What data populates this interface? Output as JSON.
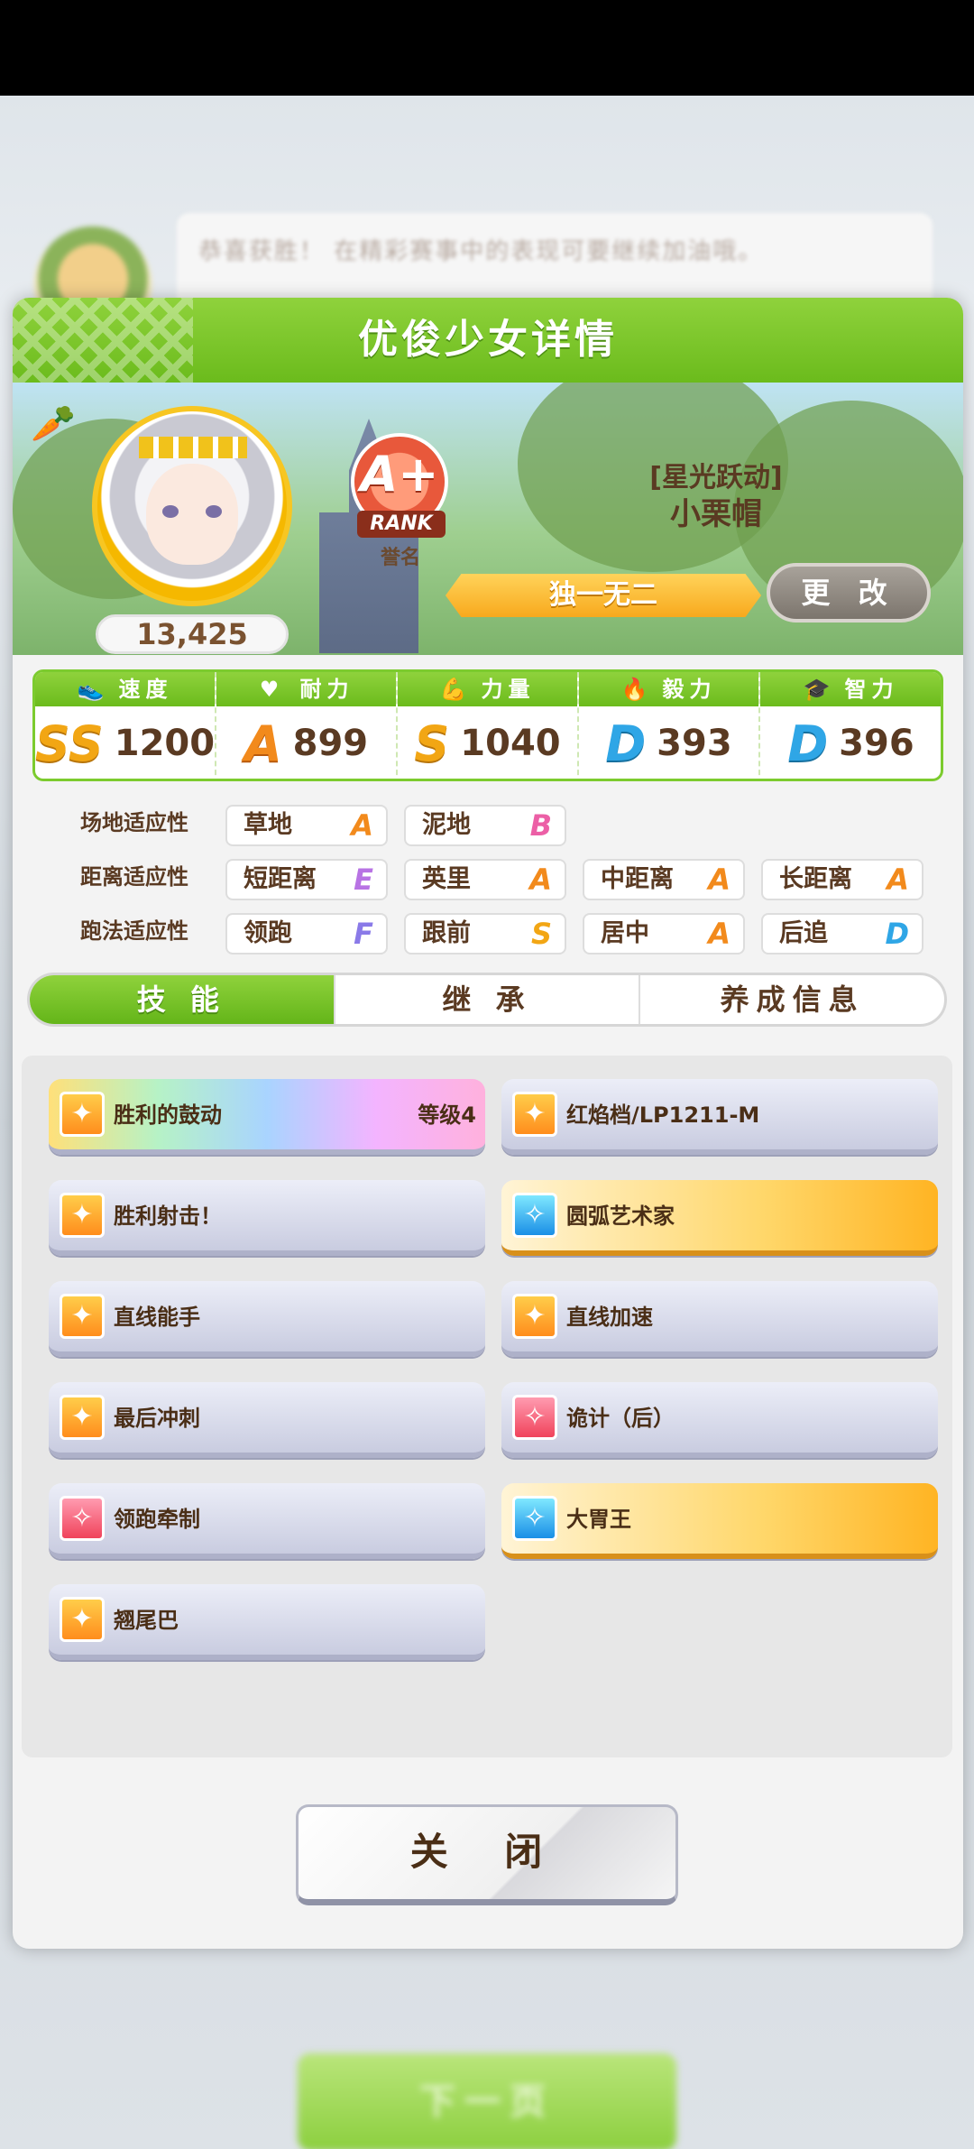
{
  "background": {
    "chat_text": "恭喜获胜！ 在精彩赛事中的表现可要继续加油哦。",
    "next_button": "下一页"
  },
  "panel": {
    "title": "优俊少女详情",
    "fans_count": "13,425",
    "rank": {
      "grade": "A+",
      "ribbon": "RANK",
      "label": "誉名"
    },
    "epithet": "[星光跃动]",
    "name": "小栗帽",
    "unique_label": "独一无二",
    "change_button": "更 改"
  },
  "stats": [
    {
      "label": "速度",
      "icon": "shoe-icon",
      "grade": "SS",
      "value": "1200"
    },
    {
      "label": "耐力",
      "icon": "heart-icon",
      "grade": "A",
      "value": "899"
    },
    {
      "label": "力量",
      "icon": "muscle-icon",
      "grade": "S",
      "value": "1040"
    },
    {
      "label": "毅力",
      "icon": "flame-icon",
      "grade": "D",
      "value": "393"
    },
    {
      "label": "智力",
      "icon": "graduation-cap-icon",
      "grade": "D",
      "value": "396"
    }
  ],
  "aptitudes": {
    "track": {
      "label": "场地适应性",
      "items": [
        {
          "name": "草地",
          "grade": "A"
        },
        {
          "name": "泥地",
          "grade": "B"
        }
      ]
    },
    "distance": {
      "label": "距离适应性",
      "items": [
        {
          "name": "短距离",
          "grade": "E"
        },
        {
          "name": "英里",
          "grade": "A"
        },
        {
          "name": "中距离",
          "grade": "A"
        },
        {
          "name": "长距离",
          "grade": "A"
        }
      ]
    },
    "style": {
      "label": "跑法适应性",
      "items": [
        {
          "name": "领跑",
          "grade": "F"
        },
        {
          "name": "跟前",
          "grade": "S"
        },
        {
          "name": "居中",
          "grade": "A"
        },
        {
          "name": "后追",
          "grade": "D"
        }
      ]
    }
  },
  "tabs": [
    "技 能",
    "继 承",
    "养成信息"
  ],
  "skills": [
    {
      "name": "胜利的鼓动",
      "level": "等级4",
      "icon": "runner-icon",
      "style": "rainbow"
    },
    {
      "name": "红焰档/LP1211-M",
      "icon": "runner-icon",
      "style": "normal"
    },
    {
      "name": "胜利射击！",
      "icon": "runner-icon",
      "style": "normal"
    },
    {
      "name": "圆弧艺术家",
      "icon": "sparkle-icon",
      "style": "gold"
    },
    {
      "name": "直线能手",
      "icon": "runner-icon",
      "style": "normal"
    },
    {
      "name": "直线加速",
      "icon": "runner-icon",
      "style": "normal"
    },
    {
      "name": "最后冲刺",
      "icon": "runner-icon",
      "style": "normal"
    },
    {
      "name": "诡计（后）",
      "icon": "sparkle-red-icon",
      "style": "normal"
    },
    {
      "name": "领跑牵制",
      "icon": "sparkle-red-icon",
      "style": "normal"
    },
    {
      "name": "大胃王",
      "icon": "sparkle-icon",
      "style": "gold"
    },
    {
      "name": "翘尾巴",
      "icon": "runner-icon",
      "style": "normal"
    }
  ],
  "close_button": "关 闭"
}
